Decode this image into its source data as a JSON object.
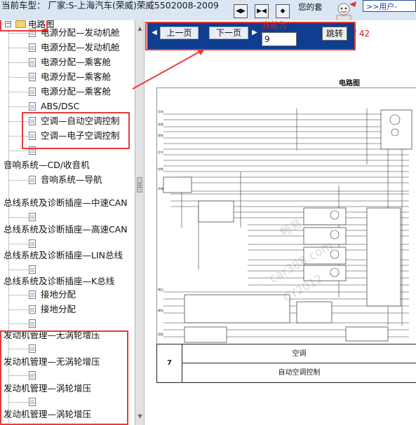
{
  "header": {
    "vehicle_label": "当前车型： 厂家:S-上海汽车(荣威)荣威5502008-2009",
    "greeting": "您的套",
    "user_link": ">>用户-"
  },
  "toolbar": {
    "buttons": [
      {
        "icon": "prev-icon"
      },
      {
        "icon": "expand-icon"
      },
      {
        "icon": "next-icon"
      }
    ]
  },
  "sidebar": {
    "root_label": "电路图",
    "items": [
      {
        "label": "电源分配—发动机舱"
      },
      {
        "label": "电源分配—发动机舱"
      },
      {
        "label": "电源分配—乘客舱"
      },
      {
        "label": "电源分配—乘客舱"
      },
      {
        "label": "电源分配—乘客舱"
      },
      {
        "label": "ABS/DSC"
      },
      {
        "label": "空调—自动空调控制"
      },
      {
        "label": "空调—电子空调控制"
      },
      {
        "label": ""
      },
      {
        "label": "音响系统—CD/收音机"
      },
      {
        "label": "音响系统—导航"
      },
      {
        "label": "总线系统及诊断插座—中速CAN"
      },
      {
        "label": ""
      },
      {
        "label": "总线系统及诊断插座—高速CAN"
      },
      {
        "label": ""
      },
      {
        "label": "总线系统及诊断插座—LIN总线"
      },
      {
        "label": ""
      },
      {
        "label": "总线系统及诊断插座—K总线"
      },
      {
        "label": "接地分配"
      },
      {
        "label": "接地分配"
      },
      {
        "label": ""
      },
      {
        "label": "发动机管理—无涡轮增压"
      },
      {
        "label": ""
      },
      {
        "label": "发动机管理—无涡轮增压"
      },
      {
        "label": ""
      },
      {
        "label": "发动机管理—涡轮增压"
      },
      {
        "label": ""
      },
      {
        "label": "发动机管理—涡轮增压"
      }
    ]
  },
  "viewer": {
    "prev_label": "上一页",
    "next_label": "下一页",
    "current_label": "当前为",
    "page_value": "9",
    "jump_label": "跳转",
    "total": "/ 42",
    "diagram_title": "电路图",
    "footer": {
      "number": "7",
      "system": "空调",
      "subsystem": "自动空调控制"
    },
    "watermarks": [
      "畅易",
      "car388.com",
      "CY2012"
    ]
  }
}
